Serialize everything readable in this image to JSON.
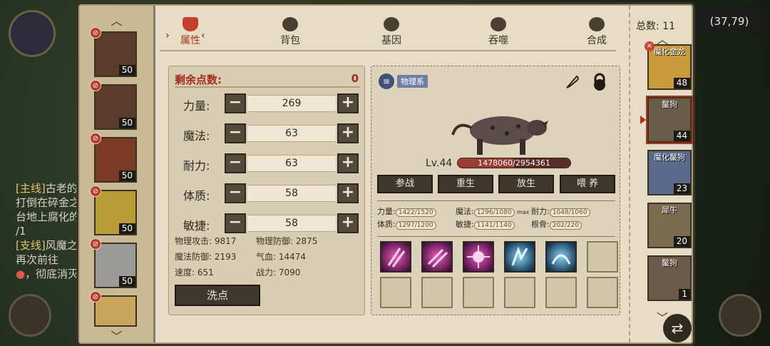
{
  "hud": {
    "coordinates": "(37,79)",
    "quest_lines": [
      {
        "tag": "[主线]",
        "text": "古老的"
      },
      {
        "tag": "",
        "text": "打倒在碎金之"
      },
      {
        "tag": "",
        "text": "台地上腐化的"
      },
      {
        "tag": "",
        "text": "/1"
      },
      {
        "tag": "[支线]",
        "text": "风魔之"
      },
      {
        "tag": "",
        "text": "再次前往"
      },
      {
        "tag": "",
        "text": "，彻底消灭"
      }
    ]
  },
  "tabs": [
    {
      "label": "属性",
      "icon": "flame-icon",
      "active": true
    },
    {
      "label": "背包",
      "icon": "bag-icon",
      "active": false
    },
    {
      "label": "基因",
      "icon": "eye-icon",
      "active": false
    },
    {
      "label": "吞噬",
      "icon": "devour-icon",
      "active": false
    },
    {
      "label": "合成",
      "icon": "merge-icon",
      "active": false
    }
  ],
  "tab_selector": {
    "left": "›",
    "right": "‹"
  },
  "roster": {
    "heroes": [
      {
        "level": "50",
        "icon": "sorceress-portrait"
      },
      {
        "level": "50",
        "icon": "fox-warrior-portrait"
      },
      {
        "level": "50",
        "icon": "red-hair-mage-portrait"
      },
      {
        "level": "50",
        "icon": "golden-beast-portrait"
      },
      {
        "level": "50",
        "icon": "white-wolf-portrait"
      },
      {
        "level": "",
        "icon": "blonde-heroine-portrait"
      }
    ]
  },
  "attributes": {
    "remaining_label": "剩余点数:",
    "remaining_value": "0",
    "items": [
      {
        "name": "力量:",
        "value": "269"
      },
      {
        "name": "魔法:",
        "value": "63"
      },
      {
        "name": "耐力:",
        "value": "63"
      },
      {
        "name": "体质:",
        "value": "58"
      },
      {
        "name": "敏捷:",
        "value": "58"
      }
    ],
    "derived": [
      {
        "text": "物理攻击: 9817"
      },
      {
        "text": "物理防御: 2875"
      },
      {
        "text": "魔法防御: 2193"
      },
      {
        "text": "气血: 14474"
      },
      {
        "text": "速度: 651"
      },
      {
        "text": "战力: 7090"
      }
    ],
    "wash_label": "洗点",
    "minus": "−",
    "plus": "+"
  },
  "monster": {
    "type_label": "物理系",
    "level_text": "Lv.44",
    "hp_text": "1478060/2954361",
    "hp_fraction": 0.5,
    "actions": [
      "参战",
      "重生",
      "放生",
      "喂 养"
    ],
    "stats": [
      {
        "label": "力量:",
        "value": "1422/1520"
      },
      {
        "label": "魔法:",
        "value": "1296/1080",
        "suffix": "max"
      },
      {
        "label": "耐力:",
        "value": "1048/1060"
      },
      {
        "label": "体质:",
        "value": "1297/1200"
      },
      {
        "label": "敏捷:",
        "value": "1141/1140"
      },
      {
        "label": "根骨:",
        "value": "202/220"
      }
    ],
    "skills": [
      {
        "kind": "pink",
        "icon": "claw-slash-icon"
      },
      {
        "kind": "pink",
        "icon": "claw-slash-icon"
      },
      {
        "kind": "pink",
        "icon": "burst-icon"
      },
      {
        "kind": "blue",
        "icon": "ice-spike-icon"
      },
      {
        "kind": "blue",
        "icon": "frost-wave-icon"
      },
      {
        "kind": "empty",
        "icon": ""
      },
      {
        "kind": "empty",
        "icon": ""
      },
      {
        "kind": "empty",
        "icon": ""
      },
      {
        "kind": "empty",
        "icon": ""
      },
      {
        "kind": "empty",
        "icon": ""
      },
      {
        "kind": "empty",
        "icon": ""
      },
      {
        "kind": "empty",
        "icon": ""
      }
    ]
  },
  "pets": {
    "total_text": "总数: 11",
    "list": [
      {
        "name": "魔化金龙",
        "level": "48",
        "has_x": true
      },
      {
        "name": "鬣狗",
        "level": "44",
        "has_x": false,
        "selected": true
      },
      {
        "name": "魔化鬣狗",
        "level": "23",
        "has_x": false
      },
      {
        "name": "犀牛",
        "level": "20",
        "has_x": false
      },
      {
        "name": "鬣狗",
        "level": "1",
        "has_x": false
      }
    ]
  }
}
